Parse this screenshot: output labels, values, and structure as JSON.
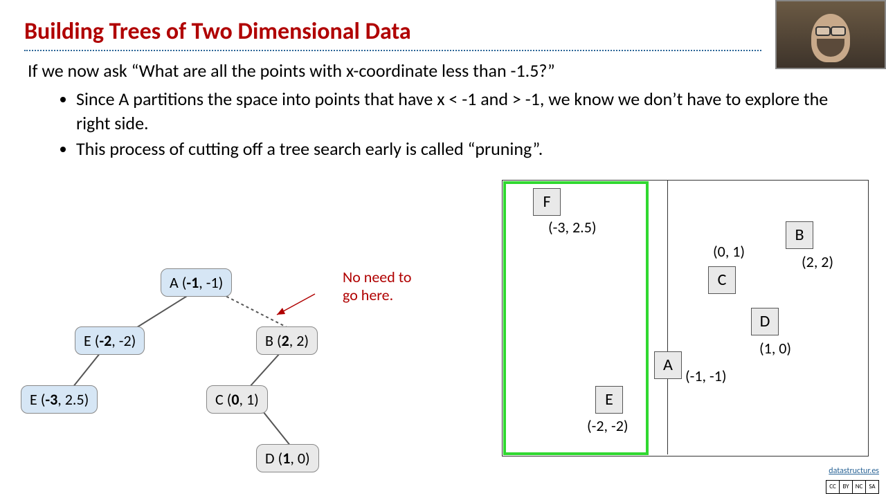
{
  "title": "Building Trees of Two Dimensional Data",
  "intro": "If we now ask “What are all the points with x-coordinate less than -1.5?”",
  "bullets": [
    "Since A partitions the space into points that have x < -1 and > -1, we know we don’t have to explore the right side.",
    "This process of cutting off a tree search early is called “pruning”."
  ],
  "annotation": {
    "line1": "No need to",
    "line2": "go here."
  },
  "tree": {
    "A": {
      "label": "A",
      "coords": "(-1, -1)",
      "bold": "-1"
    },
    "E1": {
      "label": "E",
      "coords": "(-2, -2)",
      "bold": "-2"
    },
    "E2": {
      "label": "E",
      "coords": "(-3, 2.5)",
      "bold": "-3"
    },
    "B": {
      "label": "B",
      "coords": "(2, 2)",
      "bold": "2"
    },
    "C": {
      "label": "C",
      "coords": "(0, 1)",
      "bold": "0"
    },
    "D": {
      "label": "D",
      "coords": "(1, 0)",
      "bold": "1"
    }
  },
  "points": {
    "A": {
      "label": "A",
      "coord": "(-1, -1)"
    },
    "B": {
      "label": "B",
      "coord": "(2, 2)"
    },
    "C": {
      "label": "C",
      "coord": "(0, 1)"
    },
    "D": {
      "label": "D",
      "coord": "(1, 0)"
    },
    "E": {
      "label": "E",
      "coord": "(-2, -2)"
    },
    "F": {
      "label": "F",
      "coord": "(-3, 2.5)"
    }
  },
  "footer": {
    "link": "datastructur.es",
    "cc": [
      "CC",
      "BY",
      "NC",
      "SA"
    ]
  }
}
